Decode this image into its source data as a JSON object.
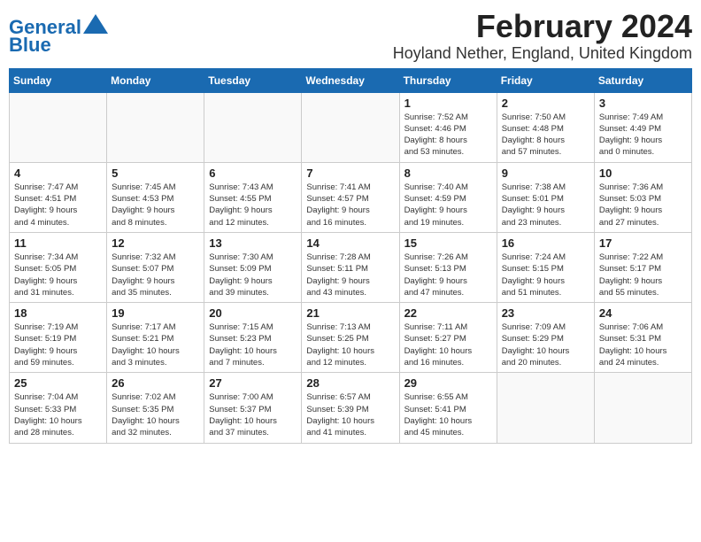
{
  "logo": {
    "line1": "General",
    "line2": "Blue"
  },
  "title": "February 2024",
  "subtitle": "Hoyland Nether, England, United Kingdom",
  "weekdays": [
    "Sunday",
    "Monday",
    "Tuesday",
    "Wednesday",
    "Thursday",
    "Friday",
    "Saturday"
  ],
  "weeks": [
    [
      {
        "day": "",
        "info": ""
      },
      {
        "day": "",
        "info": ""
      },
      {
        "day": "",
        "info": ""
      },
      {
        "day": "",
        "info": ""
      },
      {
        "day": "1",
        "info": "Sunrise: 7:52 AM\nSunset: 4:46 PM\nDaylight: 8 hours\nand 53 minutes."
      },
      {
        "day": "2",
        "info": "Sunrise: 7:50 AM\nSunset: 4:48 PM\nDaylight: 8 hours\nand 57 minutes."
      },
      {
        "day": "3",
        "info": "Sunrise: 7:49 AM\nSunset: 4:49 PM\nDaylight: 9 hours\nand 0 minutes."
      }
    ],
    [
      {
        "day": "4",
        "info": "Sunrise: 7:47 AM\nSunset: 4:51 PM\nDaylight: 9 hours\nand 4 minutes."
      },
      {
        "day": "5",
        "info": "Sunrise: 7:45 AM\nSunset: 4:53 PM\nDaylight: 9 hours\nand 8 minutes."
      },
      {
        "day": "6",
        "info": "Sunrise: 7:43 AM\nSunset: 4:55 PM\nDaylight: 9 hours\nand 12 minutes."
      },
      {
        "day": "7",
        "info": "Sunrise: 7:41 AM\nSunset: 4:57 PM\nDaylight: 9 hours\nand 16 minutes."
      },
      {
        "day": "8",
        "info": "Sunrise: 7:40 AM\nSunset: 4:59 PM\nDaylight: 9 hours\nand 19 minutes."
      },
      {
        "day": "9",
        "info": "Sunrise: 7:38 AM\nSunset: 5:01 PM\nDaylight: 9 hours\nand 23 minutes."
      },
      {
        "day": "10",
        "info": "Sunrise: 7:36 AM\nSunset: 5:03 PM\nDaylight: 9 hours\nand 27 minutes."
      }
    ],
    [
      {
        "day": "11",
        "info": "Sunrise: 7:34 AM\nSunset: 5:05 PM\nDaylight: 9 hours\nand 31 minutes."
      },
      {
        "day": "12",
        "info": "Sunrise: 7:32 AM\nSunset: 5:07 PM\nDaylight: 9 hours\nand 35 minutes."
      },
      {
        "day": "13",
        "info": "Sunrise: 7:30 AM\nSunset: 5:09 PM\nDaylight: 9 hours\nand 39 minutes."
      },
      {
        "day": "14",
        "info": "Sunrise: 7:28 AM\nSunset: 5:11 PM\nDaylight: 9 hours\nand 43 minutes."
      },
      {
        "day": "15",
        "info": "Sunrise: 7:26 AM\nSunset: 5:13 PM\nDaylight: 9 hours\nand 47 minutes."
      },
      {
        "day": "16",
        "info": "Sunrise: 7:24 AM\nSunset: 5:15 PM\nDaylight: 9 hours\nand 51 minutes."
      },
      {
        "day": "17",
        "info": "Sunrise: 7:22 AM\nSunset: 5:17 PM\nDaylight: 9 hours\nand 55 minutes."
      }
    ],
    [
      {
        "day": "18",
        "info": "Sunrise: 7:19 AM\nSunset: 5:19 PM\nDaylight: 9 hours\nand 59 minutes."
      },
      {
        "day": "19",
        "info": "Sunrise: 7:17 AM\nSunset: 5:21 PM\nDaylight: 10 hours\nand 3 minutes."
      },
      {
        "day": "20",
        "info": "Sunrise: 7:15 AM\nSunset: 5:23 PM\nDaylight: 10 hours\nand 7 minutes."
      },
      {
        "day": "21",
        "info": "Sunrise: 7:13 AM\nSunset: 5:25 PM\nDaylight: 10 hours\nand 12 minutes."
      },
      {
        "day": "22",
        "info": "Sunrise: 7:11 AM\nSunset: 5:27 PM\nDaylight: 10 hours\nand 16 minutes."
      },
      {
        "day": "23",
        "info": "Sunrise: 7:09 AM\nSunset: 5:29 PM\nDaylight: 10 hours\nand 20 minutes."
      },
      {
        "day": "24",
        "info": "Sunrise: 7:06 AM\nSunset: 5:31 PM\nDaylight: 10 hours\nand 24 minutes."
      }
    ],
    [
      {
        "day": "25",
        "info": "Sunrise: 7:04 AM\nSunset: 5:33 PM\nDaylight: 10 hours\nand 28 minutes."
      },
      {
        "day": "26",
        "info": "Sunrise: 7:02 AM\nSunset: 5:35 PM\nDaylight: 10 hours\nand 32 minutes."
      },
      {
        "day": "27",
        "info": "Sunrise: 7:00 AM\nSunset: 5:37 PM\nDaylight: 10 hours\nand 37 minutes."
      },
      {
        "day": "28",
        "info": "Sunrise: 6:57 AM\nSunset: 5:39 PM\nDaylight: 10 hours\nand 41 minutes."
      },
      {
        "day": "29",
        "info": "Sunrise: 6:55 AM\nSunset: 5:41 PM\nDaylight: 10 hours\nand 45 minutes."
      },
      {
        "day": "",
        "info": ""
      },
      {
        "day": "",
        "info": ""
      }
    ]
  ]
}
